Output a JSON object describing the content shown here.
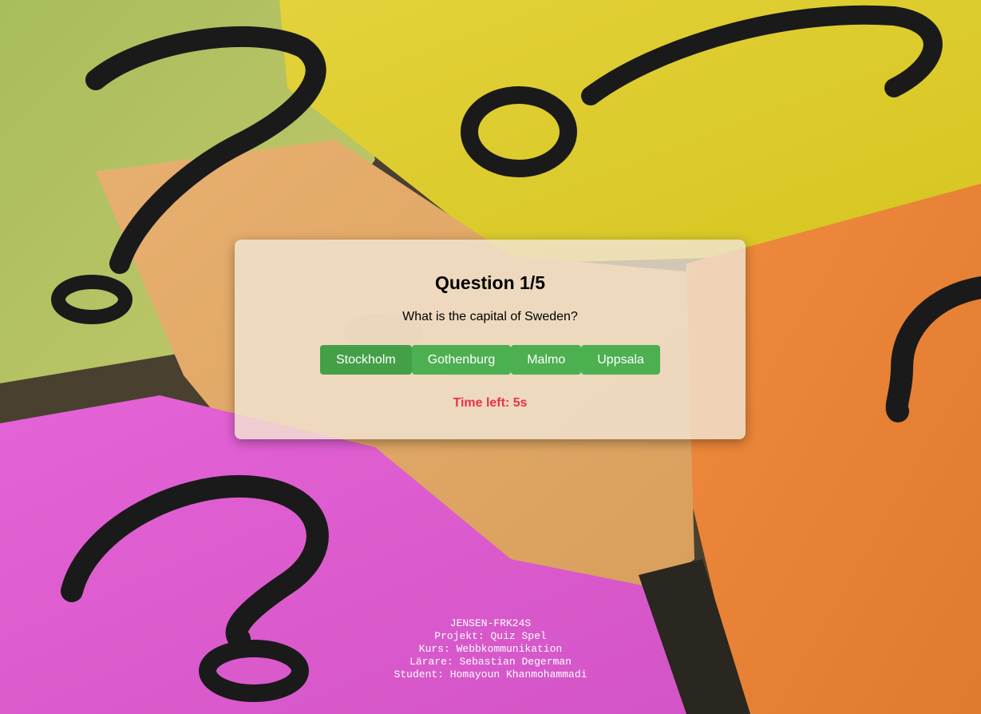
{
  "quiz": {
    "title": "Question 1/5",
    "question": "What is the capital of Sweden?",
    "answers": [
      "Stockholm",
      "Gothenburg",
      "Malmo",
      "Uppsala"
    ],
    "timer": "Time left: 5s",
    "colors": {
      "button": "#4caf50",
      "timer": "#e8334a"
    }
  },
  "footer": {
    "line1": "JENSEN-FRK24S",
    "line2": "Projekt: Quiz Spel",
    "line3": "Kurs: Webbkommunikation",
    "line4": "Lärare: Sebastian Degerman",
    "line5": "Student: Homayoun Khanmohammadi"
  }
}
